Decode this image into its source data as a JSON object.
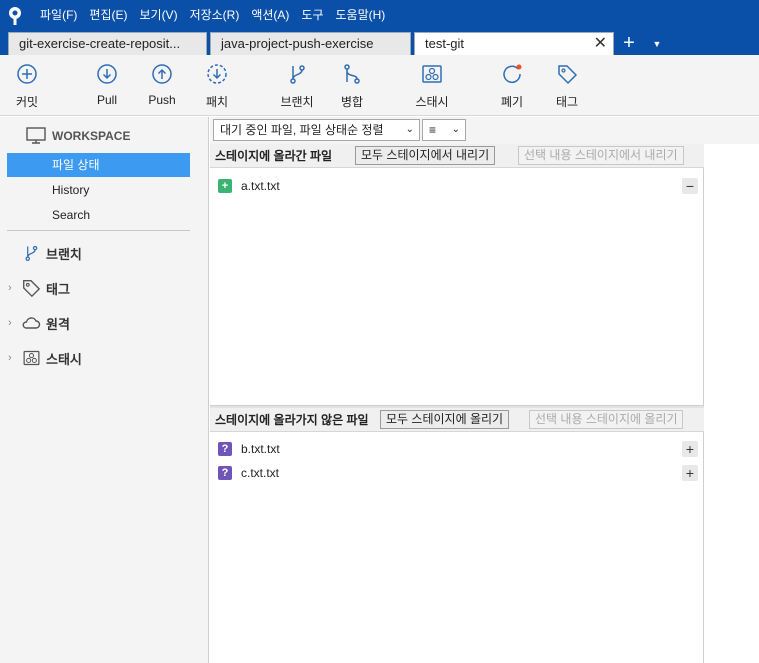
{
  "menu": [
    "파일(F)",
    "편집(E)",
    "보기(V)",
    "저장소(R)",
    "액션(A)",
    "도구",
    "도움말(H)"
  ],
  "tabs": [
    {
      "label": "git-exercise-create-reposit..."
    },
    {
      "label": "java-project-push-exercise"
    },
    {
      "label": "test-git",
      "active": true
    }
  ],
  "toolbar": {
    "commit": "커밋",
    "pull": "Pull",
    "push": "Push",
    "fetch": "패치",
    "branch": "브랜치",
    "merge": "병합",
    "stash": "스태시",
    "discard": "폐기",
    "tag": "태그"
  },
  "sidebar": {
    "workspace": "WORKSPACE",
    "items": [
      "파일 상태",
      "History",
      "Search"
    ],
    "groups": [
      "브랜치",
      "태그",
      "원격",
      "스태시"
    ]
  },
  "filter": {
    "sort": "대기 중인 파일, 파일 상태순 정렬",
    "view_icon": "≡"
  },
  "staged": {
    "title": "스테이지에 올라간 파일",
    "unstage_all": "모두 스테이지에서 내리기",
    "unstage_selected": "선택 내용 스테이지에서 내리기",
    "files": [
      "a.txt.txt"
    ]
  },
  "unstaged": {
    "title": "스테이지에 올라가지 않은 파일",
    "stage_all": "모두 스테이지에 올리기",
    "stage_selected": "선택 내용 스테이지에 올리기",
    "files": [
      "b.txt.txt",
      "c.txt.txt"
    ]
  },
  "colors": {
    "accent": "#0a4fa8",
    "selection": "#3c9bf0",
    "added": "#3cb371",
    "untracked": "#6f55b8",
    "icon": "#2f6db5"
  }
}
